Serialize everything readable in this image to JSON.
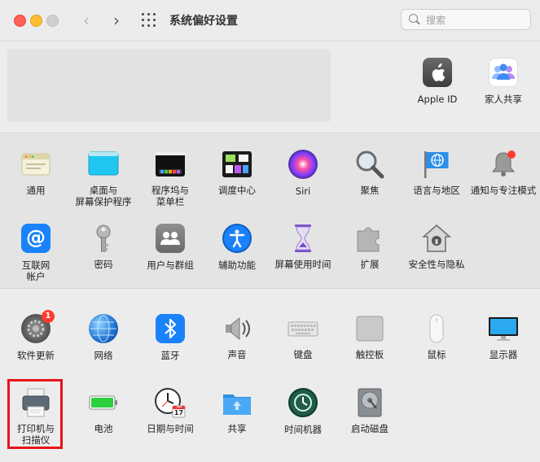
{
  "window": {
    "title": "系统偏好设置"
  },
  "search": {
    "placeholder": "搜索"
  },
  "top_items": [
    {
      "id": "apple-id",
      "label": "Apple ID",
      "icon": "apple-logo-icon"
    },
    {
      "id": "family-sharing",
      "label": "家人共享",
      "icon": "family-icon"
    }
  ],
  "row1": [
    {
      "id": "general",
      "label": "通用",
      "icon": "general-window-icon"
    },
    {
      "id": "desktop",
      "label": "桌面与\n屏幕保护程序",
      "icon": "desktop-icon"
    },
    {
      "id": "dock",
      "label": "程序坞与\n菜单栏",
      "icon": "dock-icon"
    },
    {
      "id": "mission-control",
      "label": "调度中心",
      "icon": "mission-control-icon"
    },
    {
      "id": "siri",
      "label": "Siri",
      "icon": "siri-icon"
    },
    {
      "id": "spotlight",
      "label": "聚焦",
      "icon": "magnifier-icon"
    },
    {
      "id": "language",
      "label": "语言与地区",
      "icon": "flag-icon"
    },
    {
      "id": "notifications",
      "label": "通知与专注模式",
      "icon": "bell-icon"
    }
  ],
  "row2": [
    {
      "id": "internet-accounts",
      "label": "互联网\n帐户",
      "icon": "at-sign-icon"
    },
    {
      "id": "passwords",
      "label": "密码",
      "icon": "key-icon"
    },
    {
      "id": "users",
      "label": "用户与群组",
      "icon": "users-icon"
    },
    {
      "id": "accessibility",
      "label": "辅助功能",
      "icon": "accessibility-icon"
    },
    {
      "id": "screen-time",
      "label": "屏幕使用时间",
      "icon": "hourglass-icon"
    },
    {
      "id": "extensions",
      "label": "扩展",
      "icon": "puzzle-icon"
    },
    {
      "id": "security",
      "label": "安全性与隐私",
      "icon": "house-lock-icon"
    }
  ],
  "row3": [
    {
      "id": "software-update",
      "label": "软件更新",
      "icon": "gear-icon",
      "badge": "1"
    },
    {
      "id": "network",
      "label": "网络",
      "icon": "globe-icon"
    },
    {
      "id": "bluetooth",
      "label": "蓝牙",
      "icon": "bluetooth-icon"
    },
    {
      "id": "sound",
      "label": "声音",
      "icon": "speaker-icon"
    },
    {
      "id": "keyboard",
      "label": "键盘",
      "icon": "keyboard-icon"
    },
    {
      "id": "trackpad",
      "label": "触控板",
      "icon": "trackpad-icon"
    },
    {
      "id": "mouse",
      "label": "鼠标",
      "icon": "mouse-icon"
    },
    {
      "id": "displays",
      "label": "显示器",
      "icon": "display-icon"
    }
  ],
  "row4": [
    {
      "id": "printers",
      "label": "打印机与\n扫描仪",
      "icon": "printer-icon"
    },
    {
      "id": "battery",
      "label": "电池",
      "icon": "battery-icon"
    },
    {
      "id": "date-time",
      "label": "日期与时间",
      "icon": "clock-calendar-icon",
      "calendar_month": "JUL",
      "calendar_day": "17"
    },
    {
      "id": "sharing",
      "label": "共享",
      "icon": "folder-icon"
    },
    {
      "id": "time-machine",
      "label": "时间机器",
      "icon": "time-machine-icon"
    },
    {
      "id": "startup-disk",
      "label": "启动磁盘",
      "icon": "hard-disk-icon"
    }
  ],
  "colors": {
    "highlight": "#e8141a",
    "badge": "#ff3b30",
    "bluetooth": "#1a82fb"
  }
}
